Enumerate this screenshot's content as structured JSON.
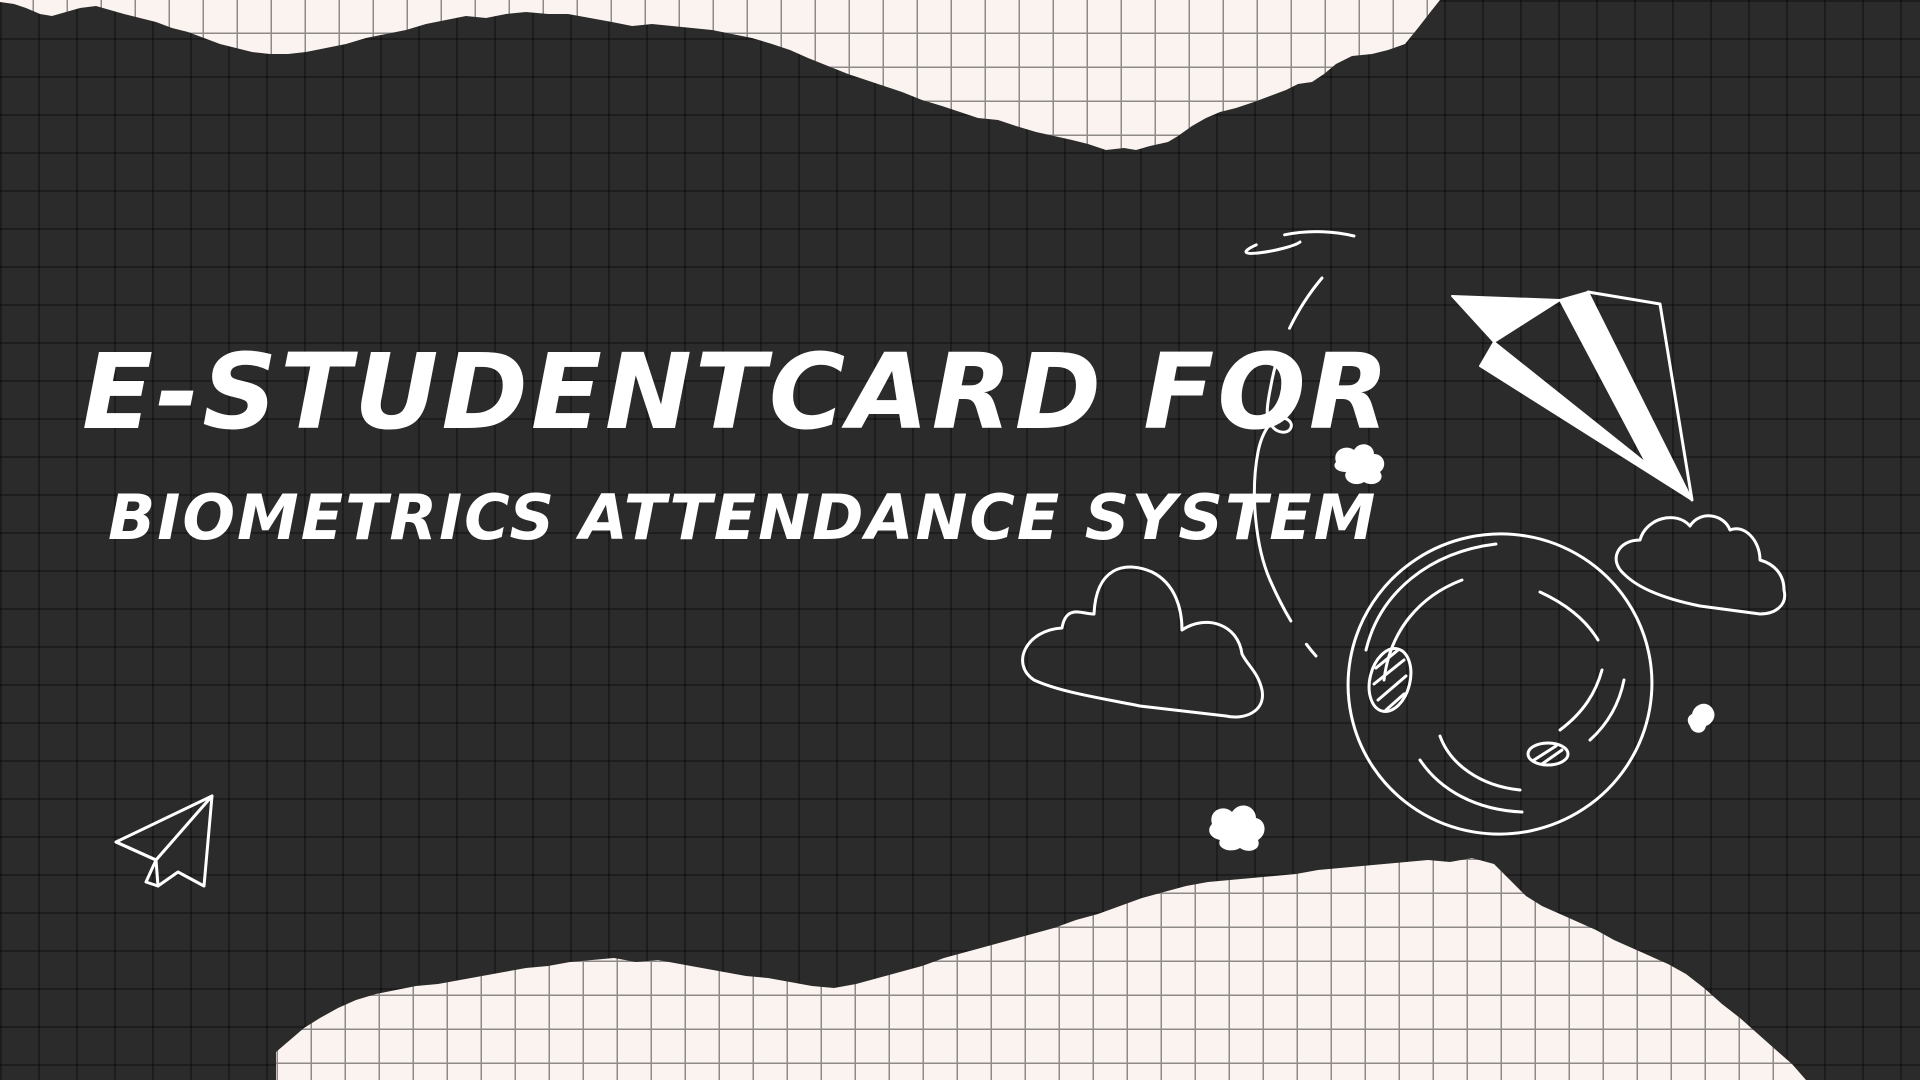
{
  "title": {
    "line1": "E-STUDENTCARD FOR",
    "line2": "BIOMETRICS ATTENDANCE SYSTEM"
  },
  "colors": {
    "board": "#2b2b2b",
    "paper": "#fbf3ef",
    "grid_line": "#8e8a88",
    "ink": "#ffffff"
  },
  "icons": [
    "torn-grid-paper-top",
    "torn-grid-paper-bottom",
    "paper-plane-icon",
    "paper-airplane-outline-icon",
    "planet-icon",
    "cloud-icon",
    "dotted-flight-path"
  ]
}
